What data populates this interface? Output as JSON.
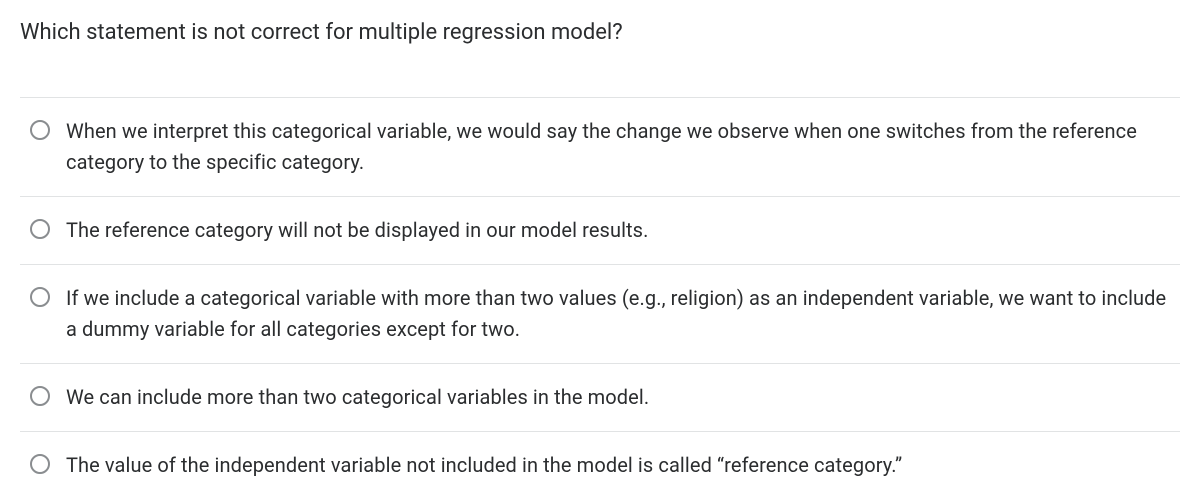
{
  "question": "Which statement is not correct for multiple regression model?",
  "options": [
    {
      "text": "When we interpret this categorical variable, we would say the change we observe when one switches from the reference category to the specific category."
    },
    {
      "text": "The reference category will not be displayed in our model results."
    },
    {
      "text": "If we include a categorical variable with more than two values (e.g., religion) as an independent variable, we want to include a dummy variable for all categories except for two."
    },
    {
      "text": "We can include more than two categorical variables in the model."
    },
    {
      "text": "The value of the independent variable not included in the model is called “reference category.”"
    }
  ]
}
